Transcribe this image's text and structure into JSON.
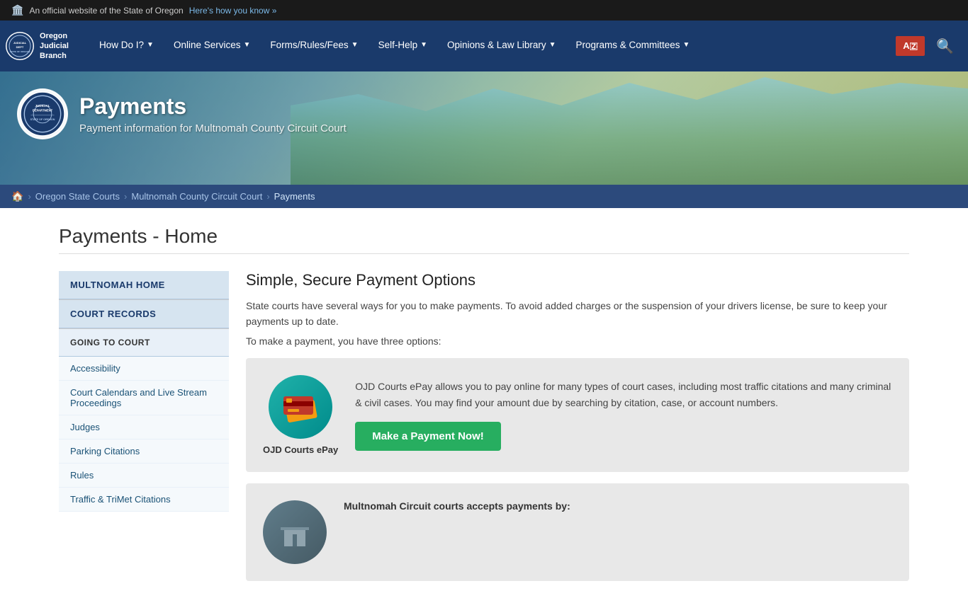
{
  "topbar": {
    "text": "An official website of the State of Oregon",
    "link_text": "Here's how you know »"
  },
  "nav": {
    "logo_line1": "Oregon",
    "logo_line2": "Judicial",
    "logo_line3": "Branch",
    "items": [
      {
        "label": "How Do I?",
        "has_dropdown": true
      },
      {
        "label": "Online Services",
        "has_dropdown": true
      },
      {
        "label": "Forms/Rules/Fees",
        "has_dropdown": true
      },
      {
        "label": "Self-Help",
        "has_dropdown": true
      },
      {
        "label": "Opinions & Law Library",
        "has_dropdown": true
      },
      {
        "label": "Programs & Committees",
        "has_dropdown": true
      }
    ],
    "translate_label": "A️",
    "search_icon": "🔍"
  },
  "hero": {
    "title": "Payments",
    "subtitle": "Payment information for Multnomah County Circuit Court",
    "seal_text": "JUDICIAL DEPT STATE OF OREGON"
  },
  "breadcrumb": {
    "home_label": "🏠",
    "items": [
      {
        "label": "Oregon State Courts",
        "href": "#"
      },
      {
        "label": "Multnomah County Circuit Court",
        "href": "#"
      },
      {
        "label": "Payments"
      }
    ]
  },
  "page_title": "Payments - Home",
  "sidebar": {
    "sections": [
      {
        "header": "MULTNOMAH HOME",
        "type": "header-only"
      },
      {
        "header": "COURT RECORDS",
        "type": "header-only"
      },
      {
        "header": "GOING TO COURT",
        "type": "header-with-links",
        "links": [
          "Accessibility",
          "Court Calendars and Live Stream Proceedings",
          "Judges",
          "Parking Citations",
          "Rules",
          "Traffic & TriMet Citations"
        ]
      }
    ]
  },
  "main": {
    "section_title": "Simple, Secure Payment Options",
    "intro1": "State courts have several ways for you to make payments. To avoid added charges or the suspension of your drivers license, be sure to keep your payments up to date.",
    "intro2": "To make a payment, you have three options:",
    "payment1": {
      "icon_label": "OJD Courts ePay",
      "description": "OJD Courts ePay allows you to pay online for many types of court cases, including most traffic citations and many criminal & civil cases. You may find your amount due by searching by citation, case, or account numbers.",
      "button_label": "Make a Payment Now!"
    },
    "payment2": {
      "header": "Multnomah Circuit courts accepts payments by:"
    }
  }
}
